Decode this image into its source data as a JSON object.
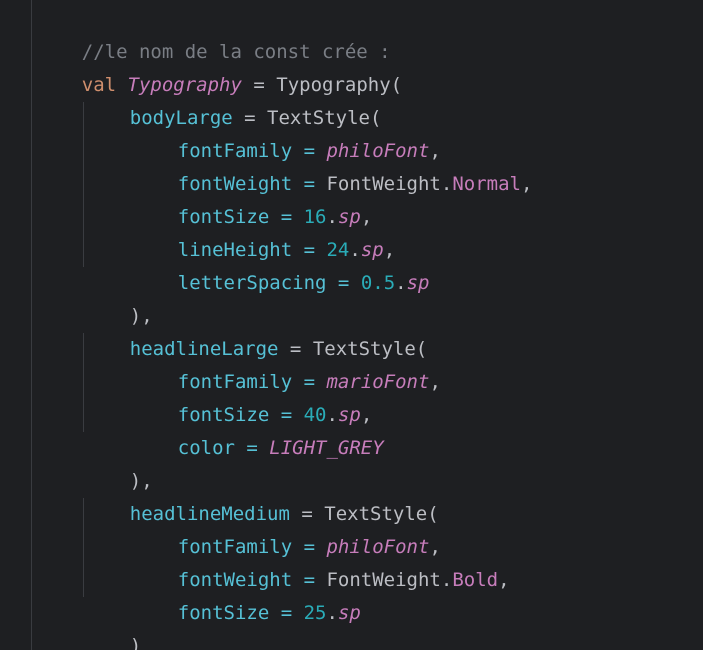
{
  "code": {
    "comment": "//le nom de la const crée :",
    "val_keyword": "val",
    "val_name": "Typography",
    "eq": " = ",
    "ctor": "Typography(",
    "blocks": [
      {
        "name": "bodyLarge",
        "ctor": "TextStyle(",
        "close": "),",
        "props": [
          {
            "key": "fontFamily",
            "value": "philoFont",
            "suffix": ","
          },
          {
            "key": "fontWeight",
            "value_prefix": "FontWeight.",
            "value": "Normal",
            "suffix": ","
          },
          {
            "key": "fontSize",
            "num": "16",
            "unit": "sp",
            "suffix": ","
          },
          {
            "key": "lineHeight",
            "num": "24",
            "unit": "sp",
            "suffix": ","
          },
          {
            "key": "letterSpacing",
            "num": "0.5",
            "unit": "sp",
            "suffix": ""
          }
        ]
      },
      {
        "name": "headlineLarge",
        "ctor": "TextStyle(",
        "close": "),",
        "props": [
          {
            "key": "fontFamily",
            "value": "marioFont",
            "suffix": ","
          },
          {
            "key": "fontSize",
            "num": "40",
            "unit": "sp",
            "suffix": ","
          },
          {
            "key": "color",
            "value": "LIGHT_GREY",
            "suffix": ""
          }
        ]
      },
      {
        "name": "headlineMedium",
        "ctor": "TextStyle(",
        "close": ")",
        "props": [
          {
            "key": "fontFamily",
            "value": "philoFont",
            "suffix": ","
          },
          {
            "key": "fontWeight",
            "value_prefix": "FontWeight.",
            "value": "Bold",
            "suffix": ","
          },
          {
            "key": "fontSize",
            "num": "25",
            "unit": "sp",
            "suffix": ""
          }
        ]
      }
    ],
    "dot": "."
  }
}
